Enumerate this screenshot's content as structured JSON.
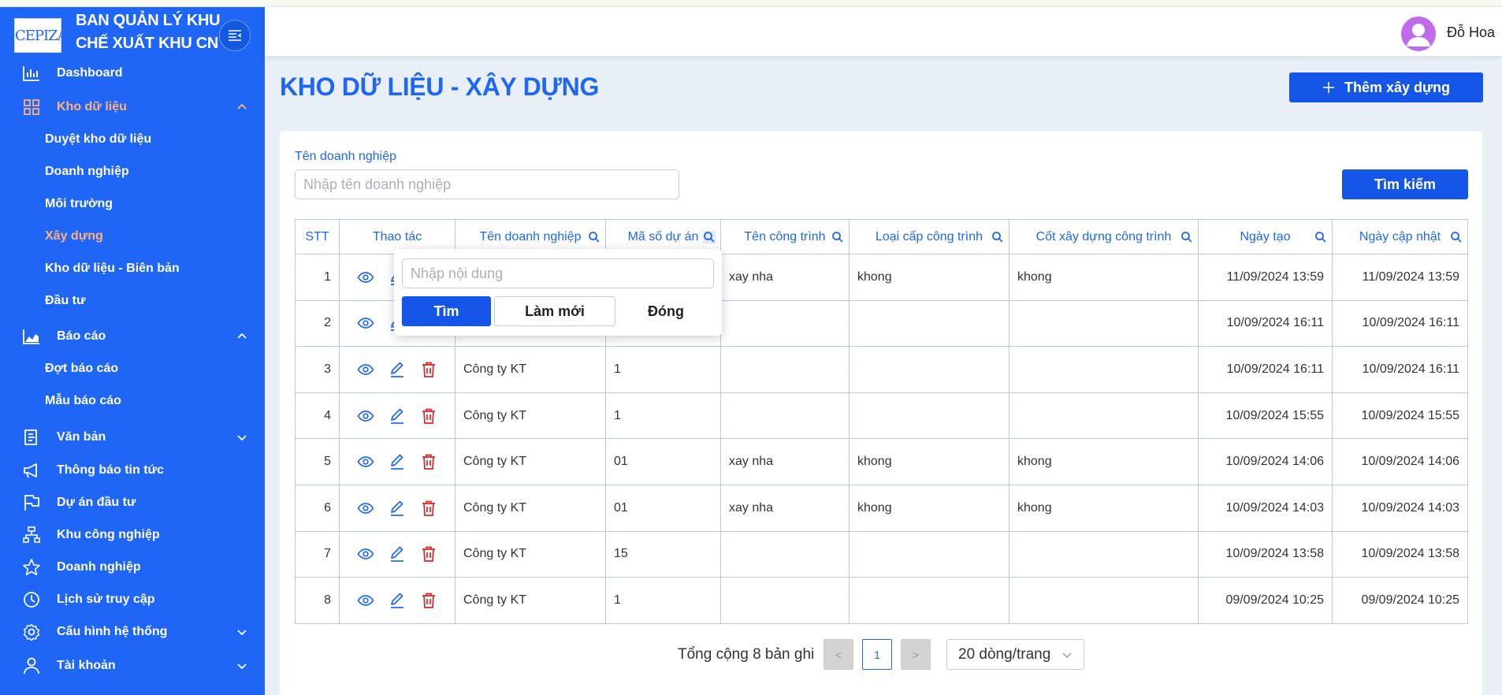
{
  "brand": {
    "logo": "CEPIZA",
    "title_line1": "BAN QUẢN LÝ KHU",
    "title_line2": "CHẾ XUẤT KHU CN"
  },
  "sidebar": {
    "items": [
      {
        "label": "Dashboard",
        "icon": "bar-chart-icon"
      },
      {
        "label": "Kho dữ liệu",
        "icon": "grid-icon",
        "expanded": true
      },
      {
        "label": "Báo cáo",
        "icon": "area-chart-icon",
        "expanded": true
      },
      {
        "label": "Văn bản",
        "icon": "document-icon"
      },
      {
        "label": "Thông báo tin tức",
        "icon": "megaphone-icon"
      },
      {
        "label": "Dự án đầu tư",
        "icon": "flag-icon"
      },
      {
        "label": "Khu công nghiệp",
        "icon": "cluster-icon"
      },
      {
        "label": "Doanh nghiệp",
        "icon": "star-icon"
      },
      {
        "label": "Lịch sử truy cập",
        "icon": "clock-icon"
      },
      {
        "label": "Cấu hình hệ thống",
        "icon": "gear-icon"
      },
      {
        "label": "Tài khoản",
        "icon": "user-icon"
      }
    ],
    "kho_sub": [
      "Duyệt kho dữ liệu",
      "Doanh nghiệp",
      "Môi trường",
      "Xây dựng",
      "Kho dữ liệu - Biên bản",
      "Đầu tư"
    ],
    "baocao_sub": [
      "Đợt báo cáo",
      "Mẫu báo cáo"
    ]
  },
  "header": {
    "user_name": "Đỗ Hoa"
  },
  "page": {
    "title": "KHO DỮ LIỆU - XÂY DỰNG",
    "add_button": "Thêm xây dựng"
  },
  "filter": {
    "label": "Tên doanh nghiệp",
    "placeholder": "Nhập tên doanh nghiệp",
    "search_button": "Tìm kiếm"
  },
  "table": {
    "columns": [
      "STT",
      "Thao tác",
      "Tên doanh nghiệp",
      "Mã số dự án",
      "Tên công trình",
      "Loại cấp công trình",
      "Cốt xây dựng công trình",
      "Ngày tạo",
      "Ngày cập nhật"
    ],
    "rows": [
      {
        "stt": "1",
        "company": "",
        "code": "",
        "name": "xay nha",
        "type": "khong",
        "level": "khong",
        "created": "11/09/2024 13:59",
        "updated": "11/09/2024 13:59"
      },
      {
        "stt": "2",
        "company": "",
        "code": "",
        "name": "",
        "type": "",
        "level": "",
        "created": "10/09/2024 16:11",
        "updated": "10/09/2024 16:11"
      },
      {
        "stt": "3",
        "company": "Công ty KT",
        "code": "1",
        "name": "",
        "type": "",
        "level": "",
        "created": "10/09/2024 16:11",
        "updated": "10/09/2024 16:11"
      },
      {
        "stt": "4",
        "company": "Công ty KT",
        "code": "1",
        "name": "",
        "type": "",
        "level": "",
        "created": "10/09/2024 15:55",
        "updated": "10/09/2024 15:55"
      },
      {
        "stt": "5",
        "company": "Công ty KT",
        "code": "01",
        "name": "xay nha",
        "type": "khong",
        "level": "khong",
        "created": "10/09/2024 14:06",
        "updated": "10/09/2024 14:06"
      },
      {
        "stt": "6",
        "company": "Công ty KT",
        "code": "01",
        "name": "xay nha",
        "type": "khong",
        "level": "khong",
        "created": "10/09/2024 14:03",
        "updated": "10/09/2024 14:03"
      },
      {
        "stt": "7",
        "company": "Công ty KT",
        "code": "15",
        "name": "",
        "type": "",
        "level": "",
        "created": "10/09/2024 13:58",
        "updated": "10/09/2024 13:58"
      },
      {
        "stt": "8",
        "company": "Công ty KT",
        "code": "1",
        "name": "",
        "type": "",
        "level": "",
        "created": "09/09/2024 10:25",
        "updated": "09/09/2024 10:25"
      }
    ]
  },
  "popup": {
    "placeholder": "Nhập nội dung",
    "find": "Tìm",
    "reset": "Làm mới",
    "close": "Đóng"
  },
  "pagination": {
    "total": "Tổng cộng 8 bản ghi",
    "prev": "<",
    "current": "1",
    "next": ">",
    "page_size": "20 dòng/trang"
  },
  "colors": {
    "primary": "#1f66f7",
    "button": "#1556e8",
    "active_menu": "#ffb27a",
    "delete": "#e02424"
  }
}
